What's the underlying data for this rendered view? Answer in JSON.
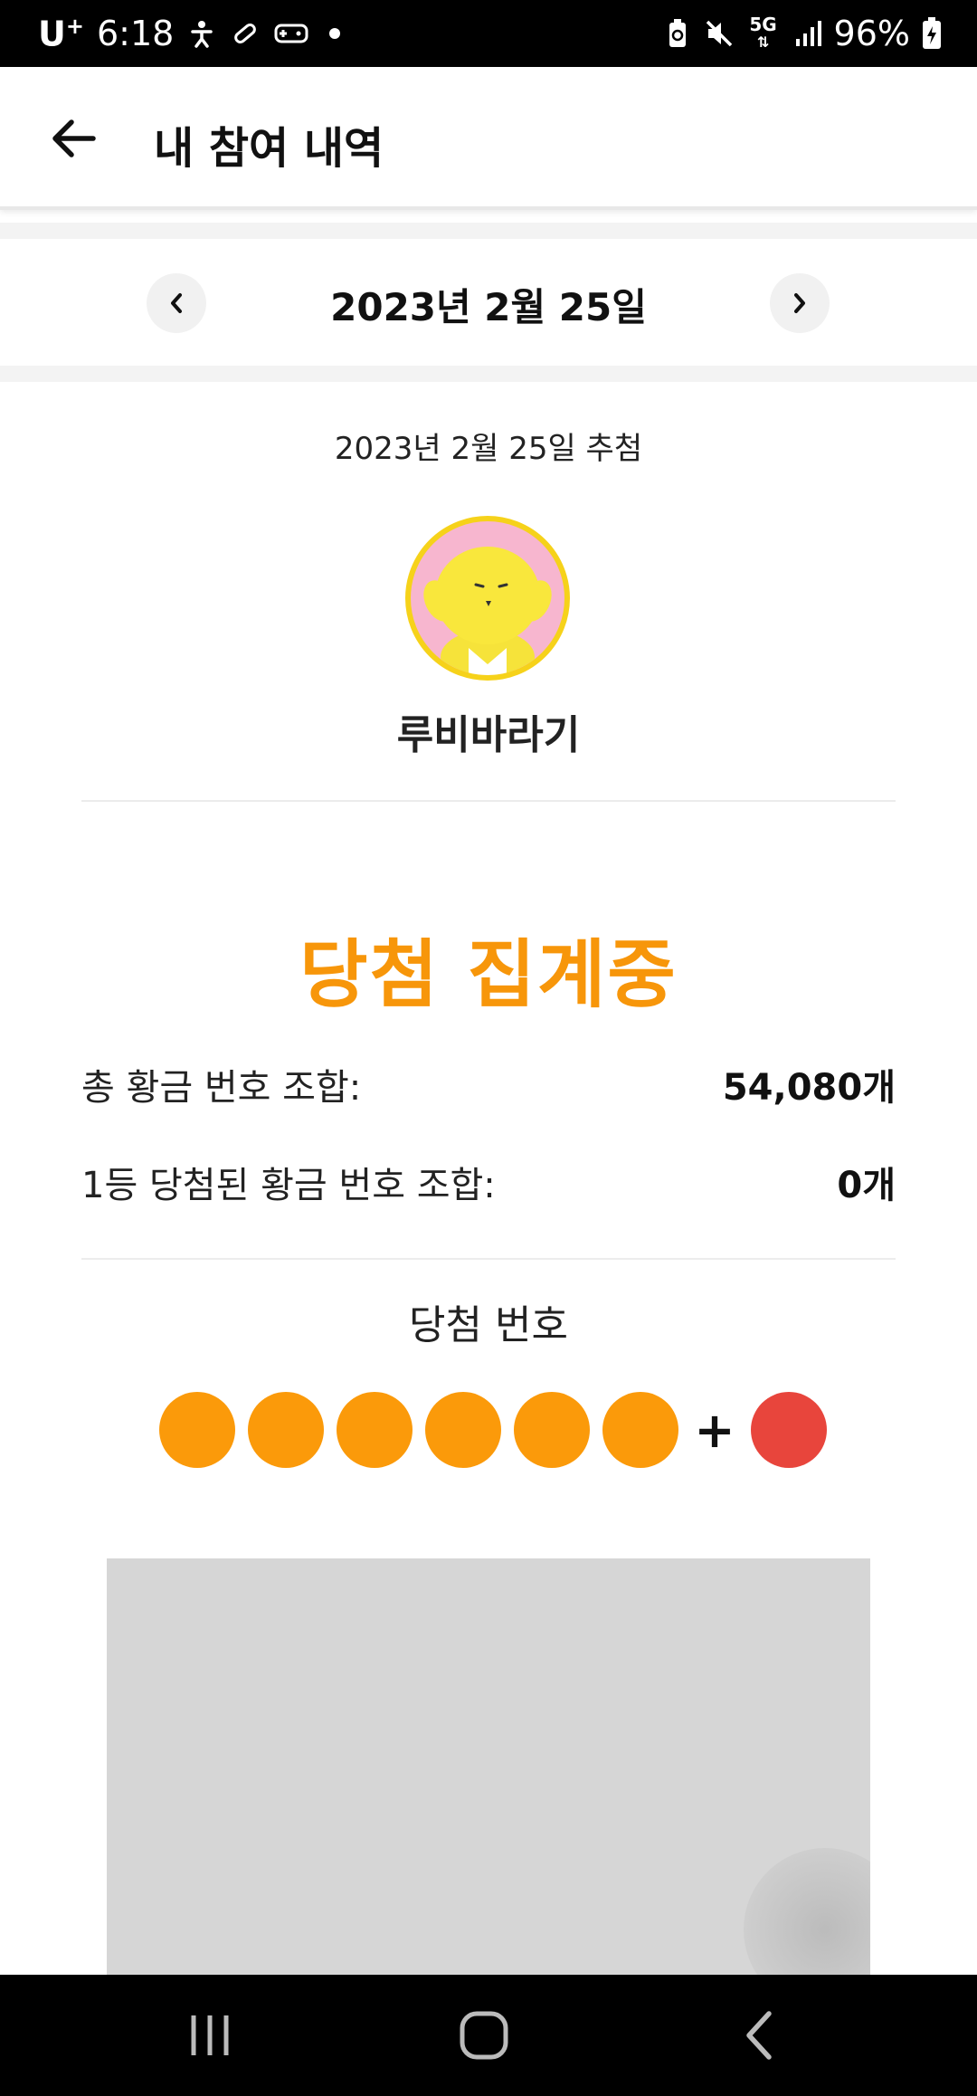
{
  "status_bar": {
    "carrier": "U",
    "carrier_sup": "+",
    "time": "6:18",
    "network": "5G",
    "battery": "96%"
  },
  "app_bar": {
    "title": "내 참여 내역",
    "back_icon": "arrow-left-icon"
  },
  "date_nav": {
    "date": "2023년 2월 25일",
    "prev_icon": "chevron-left-icon",
    "next_icon": "chevron-right-icon"
  },
  "draw": {
    "label": "2023년 2월 25일 추첨",
    "username": "루비바라기",
    "status": "당첨 집계중"
  },
  "stats": [
    {
      "label": "총 황금 번호 조합:",
      "value": "54,080개"
    },
    {
      "label": "1등 당첨된 황금 번호 조합:",
      "value": "0개"
    }
  ],
  "winning": {
    "title": "당첨 번호",
    "numbers": [
      "",
      "",
      "",
      "",
      "",
      ""
    ],
    "bonus": "",
    "plus": "+"
  },
  "colors": {
    "accent": "#f7960a",
    "ball": "#fb9a0a",
    "bonus_ball": "#e8453c",
    "avatar_bg": "#f7b6cf",
    "avatar_ring": "#f6d21a"
  }
}
